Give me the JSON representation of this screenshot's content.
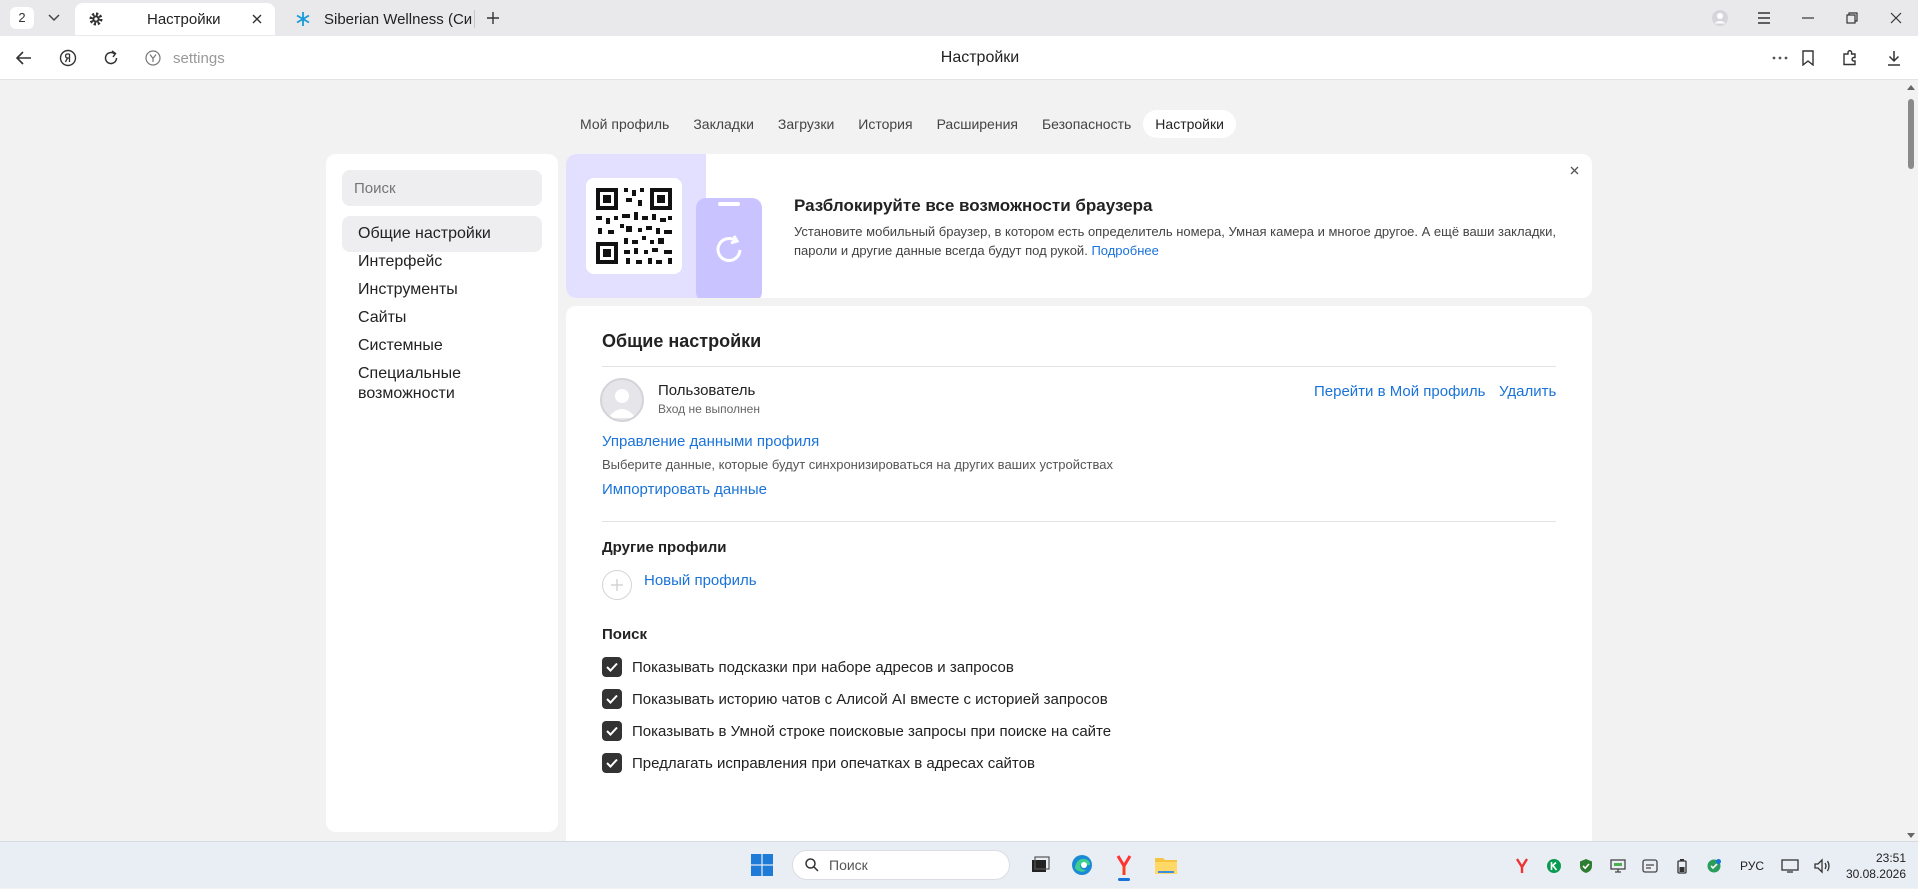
{
  "tabstrip": {
    "tab_count": "2",
    "tabs": [
      {
        "title": "Настройки",
        "active": true
      },
      {
        "title": "Siberian Wellness (Сибирс",
        "active": false
      }
    ]
  },
  "address_bar": {
    "url_text": "settings",
    "page_title": "Настройки"
  },
  "top_nav": {
    "items": [
      "Мой профиль",
      "Закладки",
      "Загрузки",
      "История",
      "Расширения",
      "Безопасность",
      "Настройки"
    ],
    "active": "Настройки"
  },
  "sidebar": {
    "search_placeholder": "Поиск",
    "items": [
      {
        "label": "Общие настройки",
        "active": true
      },
      {
        "label": "Интерфейс"
      },
      {
        "label": "Инструменты"
      },
      {
        "label": "Сайты"
      },
      {
        "label": "Системные"
      },
      {
        "label": "Специальные возможности"
      }
    ]
  },
  "banner": {
    "title": "Разблокируйте все возможности браузера",
    "text": "Установите мобильный браузер, в котором есть определитель номера, Умная камера и многое другое. А ещё ваши закладки, пароли и другие данные всегда будут под рукой.",
    "link": "Подробнее"
  },
  "main": {
    "title": "Общие настройки",
    "profile": {
      "name": "Пользователь",
      "status": "Вход не выполнен",
      "go_to_profile": "Перейти в Мой профиль",
      "delete": "Удалить"
    },
    "manage_data_link": "Управление данными профиля",
    "manage_data_desc": "Выберите данные, которые будут синхронизироваться на других ваших устройствах",
    "import_link": "Импортировать данные",
    "other_profiles": {
      "title": "Другие профили",
      "new_profile": "Новый профиль"
    },
    "search_section": {
      "title": "Поиск",
      "options": [
        {
          "label": "Показывать подсказки при наборе адресов и запросов",
          "checked": true
        },
        {
          "label": "Показывать историю чатов с Алисой AI вместе с историей запросов",
          "checked": true
        },
        {
          "label": "Показывать в Умной строке поисковые запросы при поиске на сайте",
          "checked": true
        },
        {
          "label": "Предлагать исправления при опечатках в адресах сайтов",
          "checked": true
        }
      ]
    }
  },
  "taskbar": {
    "search_placeholder": "Поиск",
    "language": "РУС",
    "time": "23:51",
    "date": "30.08.2026"
  },
  "colors": {
    "accent_link": "#1a73d9",
    "banner_bg": "#e3e0ff",
    "page_bg": "#f2f2f2"
  }
}
